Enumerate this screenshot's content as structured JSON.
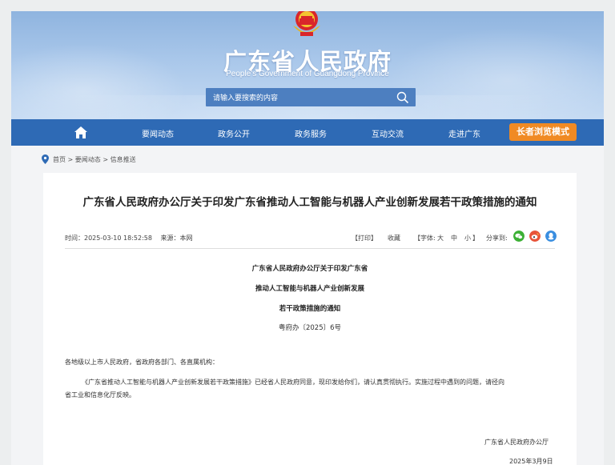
{
  "header": {
    "title": "广东省人民政府",
    "subtitle": "People's Government of Guangdong Province",
    "search_placeholder": "请输入要搜索的内容"
  },
  "nav": {
    "items": [
      "要闻动态",
      "政务公开",
      "政务服务",
      "互动交流",
      "走进广东"
    ],
    "elder_mode": "长者浏览模式"
  },
  "breadcrumb": "首页 > 要闻动态 > 信息推送",
  "article": {
    "title": "广东省人民政府办公厅关于印发广东省推动人工智能与机器人产业创新发展若干政策措施的通知",
    "time": "时间：2025-03-10 18:52:58",
    "source": "来源：本网",
    "print": "【打印】",
    "favorite": "收藏",
    "font_label": "【字体:",
    "font_large": "大",
    "font_medium": "中",
    "font_small": "小",
    "font_close": "】",
    "share_label": "分享到:",
    "doc_heading_lines": [
      "广东省人民政府办公厅关于印发广东省",
      "推动人工智能与机器人产业创新发展",
      "若干政策措施的通知"
    ],
    "doc_number": "粤府办〔2025〕6号",
    "salutation": "各地级以上市人民政府，省政府各部门、各直属机构：",
    "body_line1": "《广东省推动人工智能与机器人产业创新发展若干政策措施》已经省人民政府同意，现印发给你们，请认真贯彻执行。实施过程中遇到的问题，请径向",
    "body_line2": "省工业和信息化厅反映。",
    "signature": "广东省人民政府办公厅",
    "date": "2025年3月9日"
  },
  "colors": {
    "nav_bg": "#2e6ab5",
    "search_bg": "#4d7fc0",
    "elder_bg": "#f08a24",
    "wechat": "#3cb035",
    "weibo": "#e8543a",
    "qq": "#3a8ee0"
  }
}
